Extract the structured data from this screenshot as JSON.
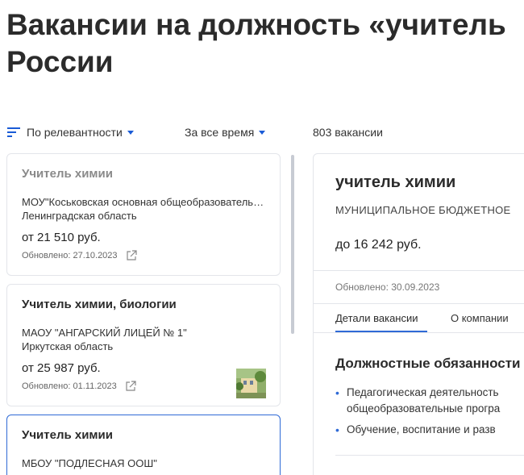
{
  "page": {
    "title_line1": "Вакансии на должность «учитель",
    "title_line2": "России"
  },
  "toolbar": {
    "sort_label": "По релевантности",
    "period_label": "За все время",
    "count_label": "803 вакансии"
  },
  "cards": [
    {
      "title": "Учитель химии",
      "org": "МОУ\"Коськовская основная общеобразовательная школа\"",
      "region": "Ленинградская область",
      "salary": "от 21 510 руб.",
      "updated": "Обновлено: 27.10.2023"
    },
    {
      "title": "Учитель химии, биологии",
      "org": "МАОУ \"АНГАРСКИЙ ЛИЦЕЙ № 1\"",
      "region": "Иркутская область",
      "salary": "от 25 987 руб.",
      "updated": "Обновлено: 01.11.2023"
    },
    {
      "title": "Учитель химии",
      "org": "МБОУ \"ПОДЛЕСНАЯ ООШ\"",
      "region": "",
      "salary": "",
      "updated": ""
    }
  ],
  "detail": {
    "title": "учитель химии",
    "org": "МУНИЦИПАЛЬНОЕ БЮДЖЕТНОЕ",
    "salary": "до 16 242 руб.",
    "updated": "Обновлено: 30.09.2023",
    "tabs": [
      "Детали вакансии",
      "О компании"
    ],
    "section_title": "Должностные обязанности",
    "duties": [
      "Педагогическая деятельность",
      "общеобразовательные програ",
      "Обучение, воспитание и разв"
    ]
  },
  "colors": {
    "accent": "#2f6ad6",
    "border": "#e3e5ea",
    "text": "#2b2b2b"
  }
}
